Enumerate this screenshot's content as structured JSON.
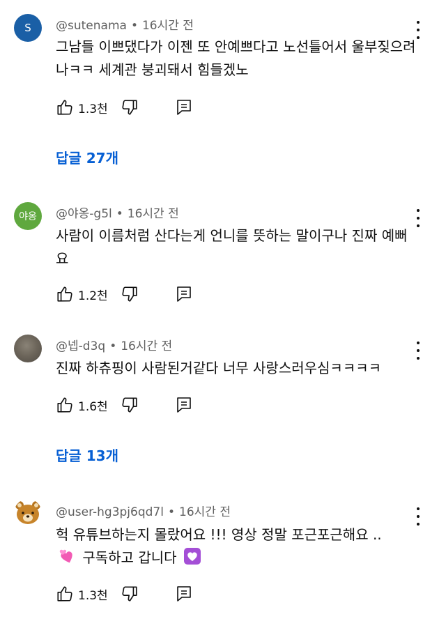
{
  "comments": [
    {
      "avatar_letter": "S",
      "avatar_color": "#1a5fa6",
      "handle": "@sutenama",
      "separator": "•",
      "time": "16시간 전",
      "text": "그남들 이쁘댔다가 이젠 또 안예쁘다고 노선틀어서 울부짖으려나ㅋㅋ 세계관 붕괴돼서 힘들겠노",
      "likes": "1.3천",
      "replies_label": "답글 27개"
    },
    {
      "avatar_letter": "야옹",
      "avatar_color": "#5fa83e",
      "handle": "@야옹-g5l",
      "separator": "•",
      "time": "16시간 전",
      "text": "사람이 이름처럼 산다는게 언니를 뜻하는 말이구나 진짜 예뻐요",
      "likes": "1.2천"
    },
    {
      "avatar_icon": "photo-avatar",
      "handle": "@넵-d3q",
      "separator": "•",
      "time": "16시간 전",
      "text": "진짜 하츄핑이 사람된거같다 너무 사랑스러우심ㅋㅋㅋㅋ",
      "likes": "1.6천",
      "replies_label": "답글 13개"
    },
    {
      "avatar_icon": "bear-avatar",
      "handle": "@user-hg3pj6qd7l",
      "separator": "•",
      "time": "16시간 전",
      "text_line1": "헉 유튜브하는지 몰랐어요 !!! 영상 정말 포근포근해요 ..",
      "text_line2": "구독하고 갑니다",
      "emoji_1": "revolving-hearts-emoji",
      "emoji_2": "heart-decoration-emoji",
      "likes": "1.3천"
    }
  ],
  "colors": {
    "link_blue": "#065fd4",
    "meta_gray": "#606060",
    "text": "#0f0f0f"
  },
  "icons": {
    "like": "thumbs-up-icon",
    "dislike": "thumbs-down-icon",
    "reply": "reply-icon",
    "more": "more-vert-icon"
  }
}
